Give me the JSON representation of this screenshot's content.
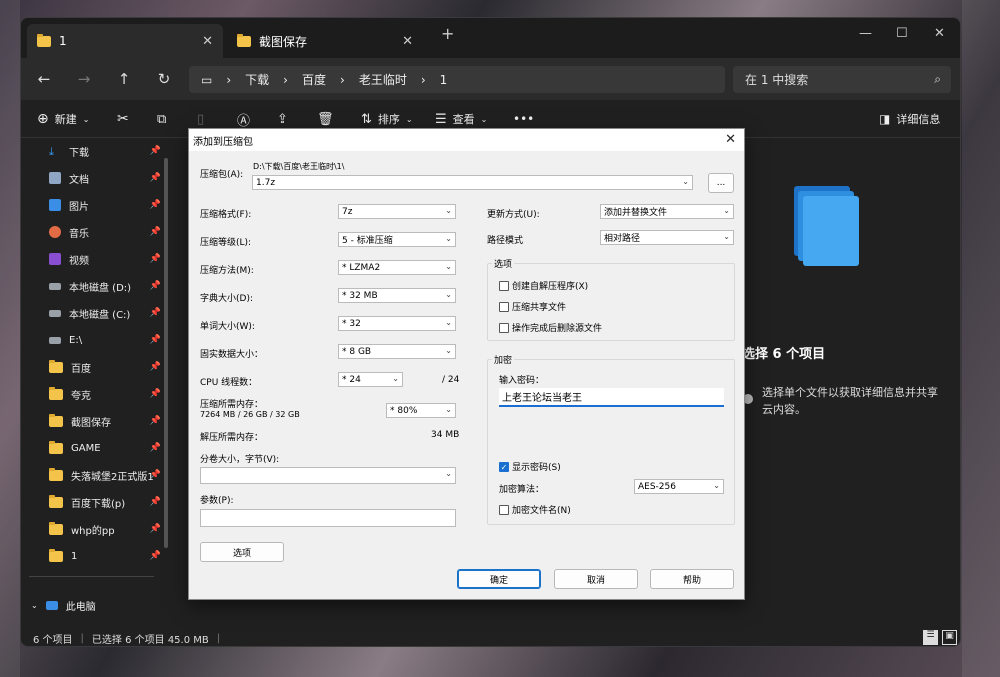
{
  "tabs": [
    {
      "label": "1"
    },
    {
      "label": "截图保存"
    }
  ],
  "new_tab": "+",
  "window_controls": {
    "minimize": "—",
    "maximize": "☐",
    "close": "✕"
  },
  "breadcrumb": [
    "下载",
    "百度",
    "老王临时",
    "1"
  ],
  "search_placeholder": "在 1 中搜索",
  "toolbar": {
    "new": "新建",
    "sort": "排序",
    "view": "查看",
    "more": "•••",
    "details": "详细信息"
  },
  "sidebar": {
    "items": [
      {
        "label": "下载",
        "color": "#3aa0ff"
      },
      {
        "label": "文档",
        "color": "#8fa6c4"
      },
      {
        "label": "图片",
        "color": "#3a8ee6"
      },
      {
        "label": "音乐",
        "color": "#e06b45"
      },
      {
        "label": "视频",
        "color": "#8a4fd0"
      },
      {
        "label": "本地磁盘 (D:)",
        "color": "#9aa0a8"
      },
      {
        "label": "本地磁盘 (C:)",
        "color": "#9aa0a8"
      },
      {
        "label": "E:\\",
        "color": "#9aa0a8"
      },
      {
        "label": "百度",
        "color": "#f4c34a"
      },
      {
        "label": "夸克",
        "color": "#f4c34a"
      },
      {
        "label": "截图保存",
        "color": "#f4c34a"
      },
      {
        "label": "GAME",
        "color": "#f4c34a"
      },
      {
        "label": "失落城堡2正式版1",
        "color": "#f4c34a"
      },
      {
        "label": "百度下载(p)",
        "color": "#f4c34a"
      },
      {
        "label": "whp的pp",
        "color": "#f4c34a"
      },
      {
        "label": "1",
        "color": "#f4c34a"
      }
    ],
    "this_pc": "此电脑"
  },
  "status": {
    "count": "6 个项目",
    "selected": "已选择 6 个项目  45.0 MB"
  },
  "details_pane": {
    "title": "选择 6 个项目",
    "desc": "选择单个文件以获取详细信息并共享云内容。"
  },
  "dialog": {
    "title": "添加到压缩包",
    "archive_label": "压缩包(A):",
    "archive_path": "D:\\下载\\百度\\老王临时\\1\\",
    "archive_name": "1.7z",
    "browse": "...",
    "format_label": "压缩格式(F):",
    "format": "7z",
    "level_label": "压缩等级(L):",
    "level": "5 - 标准压缩",
    "method_label": "压缩方法(M):",
    "method": "* LZMA2",
    "dict_label": "字典大小(D):",
    "dict": "* 32 MB",
    "word_label": "单词大小(W):",
    "word": "* 32",
    "solid_label": "固实数据大小：",
    "solid": "* 8 GB",
    "threads_label": "CPU 线程数：",
    "threads": "* 24",
    "threads_max": "/ 24",
    "mem_label": "压缩所需内存：",
    "mem_detail": "7264 MB / 26 GB / 32 GB",
    "mem_pct": "* 80%",
    "demem_label": "解压所需内存：",
    "demem": "34 MB",
    "volume_label": "分卷大小，字节(V):",
    "params_label": "参数(P):",
    "options_btn": "选项",
    "update_label": "更新方式(U):",
    "update": "添加并替换文件",
    "path_label": "路径模式",
    "path": "相对路径",
    "options_group": "选项",
    "opt_sfx": "创建自解压程序(X)",
    "opt_shared": "压缩共享文件",
    "opt_delete": "操作完成后删除源文件",
    "enc_group": "加密",
    "pwd_label": "输入密码：",
    "pwd": "上老王论坛当老王",
    "show_pwd": "显示密码(S)",
    "enc_method_label": "加密算法：",
    "enc_method": "AES-256",
    "enc_names": "加密文件名(N)",
    "ok": "确定",
    "cancel": "取消",
    "help": "帮助"
  }
}
